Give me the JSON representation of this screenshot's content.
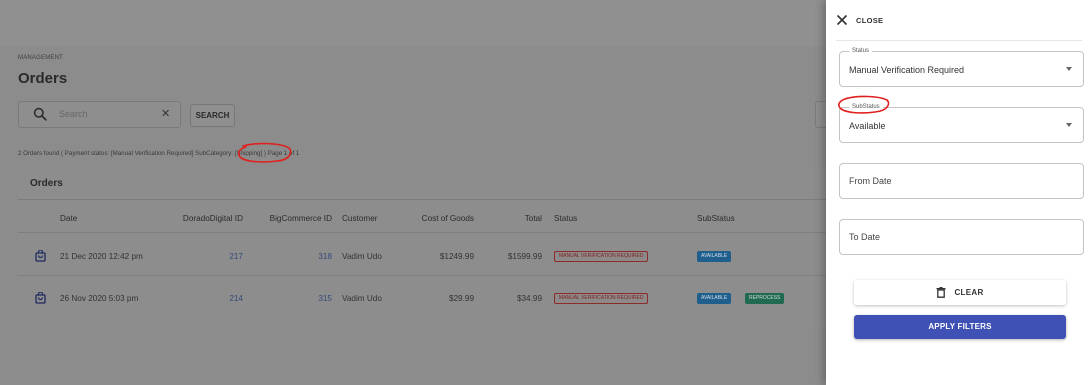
{
  "page": {
    "breadcrumb": "MANAGEMENT",
    "title": "Orders"
  },
  "search": {
    "placeholder": "Search",
    "clear_icon": "close-icon",
    "button_label": "SEARCH"
  },
  "summary": {
    "prefix": "2 Orders found ( Payment status: [Manual Verification Required] ",
    "highlight": "SubCategory:",
    "suffix": " [Shipping] ) Page 1 of 1"
  },
  "orders_card": {
    "title": "Orders",
    "columns": [
      "Date",
      "DoradoDigital ID",
      "BigCommerce ID",
      "Customer",
      "Cost of Goods",
      "Total",
      "Status",
      "SubStatus"
    ],
    "rows": [
      {
        "icon": "shopping-bag-icon",
        "date": "21 Dec 2020 12:42 pm",
        "dorado_id": "217",
        "bigcommerce_id": "318",
        "customer": "Vadim Udo",
        "cost_of_goods": "$1249.99",
        "total": "$1599.99",
        "status": "MANUAL VERIFICATION REQUIRED",
        "substatus": [
          "AVAILABLE"
        ]
      },
      {
        "icon": "shopping-bag-icon",
        "date": "26 Nov 2020 5:03 pm",
        "dorado_id": "214",
        "bigcommerce_id": "315",
        "customer": "Vadim Udo",
        "cost_of_goods": "$29.99",
        "total": "$34.99",
        "status": "MANUAL VERIFICATION REQUIRED",
        "substatus": [
          "AVAILABLE",
          "REPROCESS"
        ]
      }
    ]
  },
  "drawer": {
    "close_label": "CLOSE",
    "status": {
      "label": "Status",
      "value": "Manual Verification Required"
    },
    "substatus": {
      "label": "SubStatus",
      "value": "Available"
    },
    "from_date": {
      "placeholder": "From Date"
    },
    "to_date": {
      "placeholder": "To Date"
    },
    "clear_label": "CLEAR",
    "apply_label": "APPLY FILTERS"
  },
  "colors": {
    "primary": "#3f51b5",
    "annotation": "#e0201e",
    "status_chip": "#8b2b2b",
    "available_chip": "#1f5f8e",
    "reprocess_chip": "#1f6a50"
  }
}
